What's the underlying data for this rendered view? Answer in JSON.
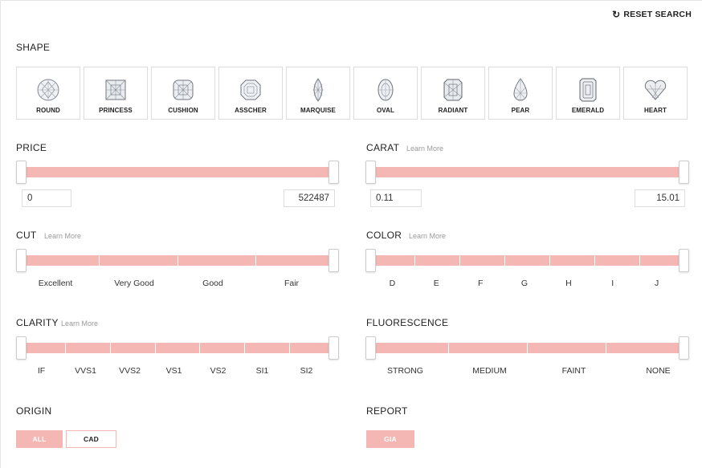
{
  "reset_label": "RESET SEARCH",
  "shape": {
    "title": "SHAPE",
    "items": [
      {
        "label": "ROUND",
        "icon": "round-diamond-icon"
      },
      {
        "label": "PRINCESS",
        "icon": "princess-diamond-icon"
      },
      {
        "label": "CUSHION",
        "icon": "cushion-diamond-icon"
      },
      {
        "label": "ASSCHER",
        "icon": "asscher-diamond-icon"
      },
      {
        "label": "MARQUISE",
        "icon": "marquise-diamond-icon"
      },
      {
        "label": "OVAL",
        "icon": "oval-diamond-icon"
      },
      {
        "label": "RADIANT",
        "icon": "radiant-diamond-icon"
      },
      {
        "label": "PEAR",
        "icon": "pear-diamond-icon"
      },
      {
        "label": "EMERALD",
        "icon": "emerald-diamond-icon"
      },
      {
        "label": "HEART",
        "icon": "heart-diamond-icon"
      }
    ]
  },
  "price": {
    "title": "PRICE",
    "min": "0",
    "max": "522487"
  },
  "carat": {
    "title": "CARAT",
    "learn": "Learn More",
    "min": "0.11",
    "max": "15.01"
  },
  "cut": {
    "title": "CUT",
    "learn": "Learn More",
    "ticks": [
      "Excellent",
      "Very Good",
      "Good",
      "Fair"
    ]
  },
  "color": {
    "title": "COLOR",
    "learn": "Learn More",
    "ticks": [
      "D",
      "E",
      "F",
      "G",
      "H",
      "I",
      "J"
    ]
  },
  "clarity": {
    "title": "CLARITY",
    "learn": "Learn More",
    "ticks": [
      "IF",
      "VVS1",
      "VVS2",
      "VS1",
      "VS2",
      "SI1",
      "SI2"
    ]
  },
  "fluorescence": {
    "title": "FLUORESCENCE",
    "ticks": [
      "STRONG",
      "MEDIUM",
      "FAINT",
      "NONE"
    ]
  },
  "origin": {
    "title": "ORIGIN",
    "buttons": [
      "ALL",
      "CAD"
    ],
    "selected": "ALL"
  },
  "report": {
    "title": "REPORT",
    "buttons": [
      "GIA"
    ],
    "selected": "GIA"
  },
  "colors": {
    "accent": "#f5b7b3",
    "border": "#dddddd",
    "text": "#222222",
    "muted": "#999999"
  }
}
